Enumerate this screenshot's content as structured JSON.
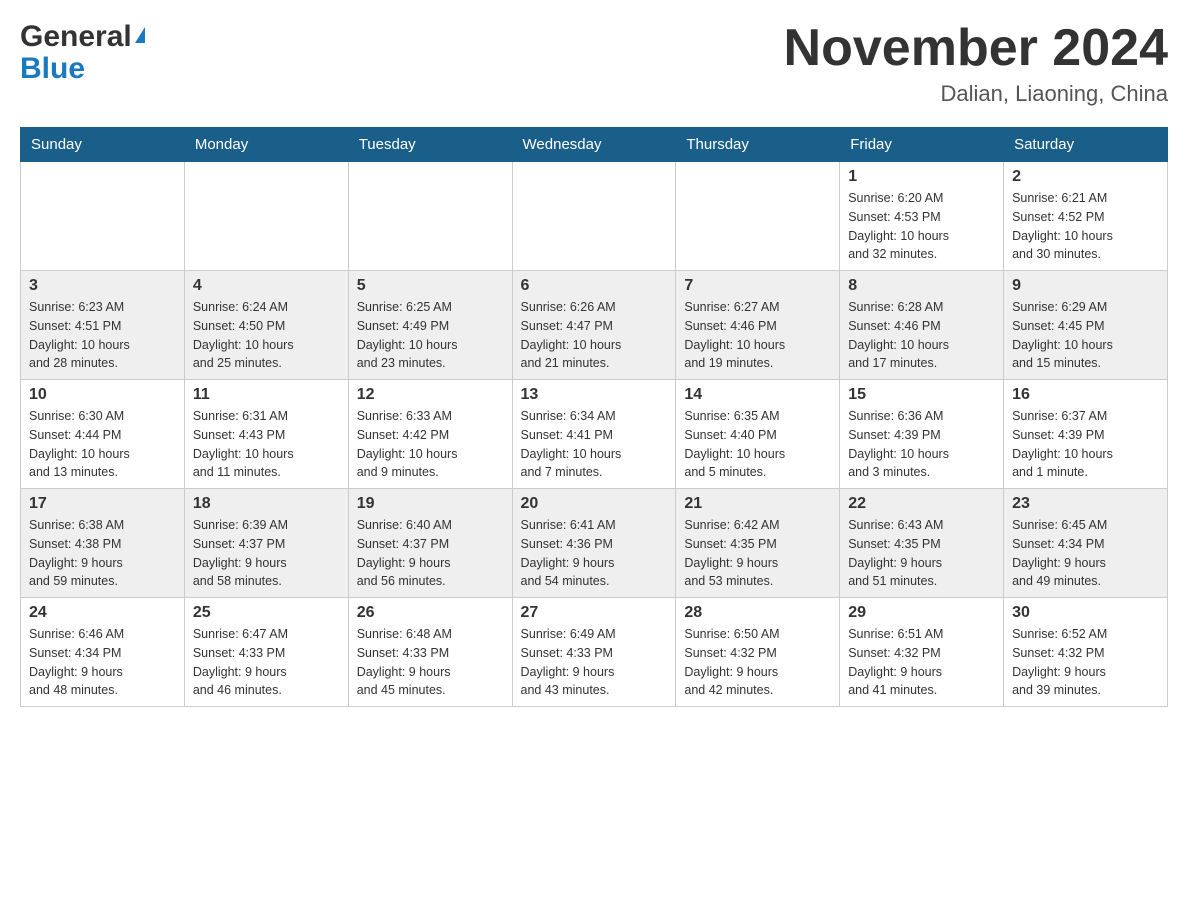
{
  "header": {
    "logo_general": "General",
    "logo_blue": "Blue",
    "title": "November 2024",
    "subtitle": "Dalian, Liaoning, China"
  },
  "weekdays": [
    "Sunday",
    "Monday",
    "Tuesday",
    "Wednesday",
    "Thursday",
    "Friday",
    "Saturday"
  ],
  "weeks": [
    [
      {
        "day": "",
        "info": ""
      },
      {
        "day": "",
        "info": ""
      },
      {
        "day": "",
        "info": ""
      },
      {
        "day": "",
        "info": ""
      },
      {
        "day": "",
        "info": ""
      },
      {
        "day": "1",
        "info": "Sunrise: 6:20 AM\nSunset: 4:53 PM\nDaylight: 10 hours\nand 32 minutes."
      },
      {
        "day": "2",
        "info": "Sunrise: 6:21 AM\nSunset: 4:52 PM\nDaylight: 10 hours\nand 30 minutes."
      }
    ],
    [
      {
        "day": "3",
        "info": "Sunrise: 6:23 AM\nSunset: 4:51 PM\nDaylight: 10 hours\nand 28 minutes."
      },
      {
        "day": "4",
        "info": "Sunrise: 6:24 AM\nSunset: 4:50 PM\nDaylight: 10 hours\nand 25 minutes."
      },
      {
        "day": "5",
        "info": "Sunrise: 6:25 AM\nSunset: 4:49 PM\nDaylight: 10 hours\nand 23 minutes."
      },
      {
        "day": "6",
        "info": "Sunrise: 6:26 AM\nSunset: 4:47 PM\nDaylight: 10 hours\nand 21 minutes."
      },
      {
        "day": "7",
        "info": "Sunrise: 6:27 AM\nSunset: 4:46 PM\nDaylight: 10 hours\nand 19 minutes."
      },
      {
        "day": "8",
        "info": "Sunrise: 6:28 AM\nSunset: 4:46 PM\nDaylight: 10 hours\nand 17 minutes."
      },
      {
        "day": "9",
        "info": "Sunrise: 6:29 AM\nSunset: 4:45 PM\nDaylight: 10 hours\nand 15 minutes."
      }
    ],
    [
      {
        "day": "10",
        "info": "Sunrise: 6:30 AM\nSunset: 4:44 PM\nDaylight: 10 hours\nand 13 minutes."
      },
      {
        "day": "11",
        "info": "Sunrise: 6:31 AM\nSunset: 4:43 PM\nDaylight: 10 hours\nand 11 minutes."
      },
      {
        "day": "12",
        "info": "Sunrise: 6:33 AM\nSunset: 4:42 PM\nDaylight: 10 hours\nand 9 minutes."
      },
      {
        "day": "13",
        "info": "Sunrise: 6:34 AM\nSunset: 4:41 PM\nDaylight: 10 hours\nand 7 minutes."
      },
      {
        "day": "14",
        "info": "Sunrise: 6:35 AM\nSunset: 4:40 PM\nDaylight: 10 hours\nand 5 minutes."
      },
      {
        "day": "15",
        "info": "Sunrise: 6:36 AM\nSunset: 4:39 PM\nDaylight: 10 hours\nand 3 minutes."
      },
      {
        "day": "16",
        "info": "Sunrise: 6:37 AM\nSunset: 4:39 PM\nDaylight: 10 hours\nand 1 minute."
      }
    ],
    [
      {
        "day": "17",
        "info": "Sunrise: 6:38 AM\nSunset: 4:38 PM\nDaylight: 9 hours\nand 59 minutes."
      },
      {
        "day": "18",
        "info": "Sunrise: 6:39 AM\nSunset: 4:37 PM\nDaylight: 9 hours\nand 58 minutes."
      },
      {
        "day": "19",
        "info": "Sunrise: 6:40 AM\nSunset: 4:37 PM\nDaylight: 9 hours\nand 56 minutes."
      },
      {
        "day": "20",
        "info": "Sunrise: 6:41 AM\nSunset: 4:36 PM\nDaylight: 9 hours\nand 54 minutes."
      },
      {
        "day": "21",
        "info": "Sunrise: 6:42 AM\nSunset: 4:35 PM\nDaylight: 9 hours\nand 53 minutes."
      },
      {
        "day": "22",
        "info": "Sunrise: 6:43 AM\nSunset: 4:35 PM\nDaylight: 9 hours\nand 51 minutes."
      },
      {
        "day": "23",
        "info": "Sunrise: 6:45 AM\nSunset: 4:34 PM\nDaylight: 9 hours\nand 49 minutes."
      }
    ],
    [
      {
        "day": "24",
        "info": "Sunrise: 6:46 AM\nSunset: 4:34 PM\nDaylight: 9 hours\nand 48 minutes."
      },
      {
        "day": "25",
        "info": "Sunrise: 6:47 AM\nSunset: 4:33 PM\nDaylight: 9 hours\nand 46 minutes."
      },
      {
        "day": "26",
        "info": "Sunrise: 6:48 AM\nSunset: 4:33 PM\nDaylight: 9 hours\nand 45 minutes."
      },
      {
        "day": "27",
        "info": "Sunrise: 6:49 AM\nSunset: 4:33 PM\nDaylight: 9 hours\nand 43 minutes."
      },
      {
        "day": "28",
        "info": "Sunrise: 6:50 AM\nSunset: 4:32 PM\nDaylight: 9 hours\nand 42 minutes."
      },
      {
        "day": "29",
        "info": "Sunrise: 6:51 AM\nSunset: 4:32 PM\nDaylight: 9 hours\nand 41 minutes."
      },
      {
        "day": "30",
        "info": "Sunrise: 6:52 AM\nSunset: 4:32 PM\nDaylight: 9 hours\nand 39 minutes."
      }
    ]
  ]
}
